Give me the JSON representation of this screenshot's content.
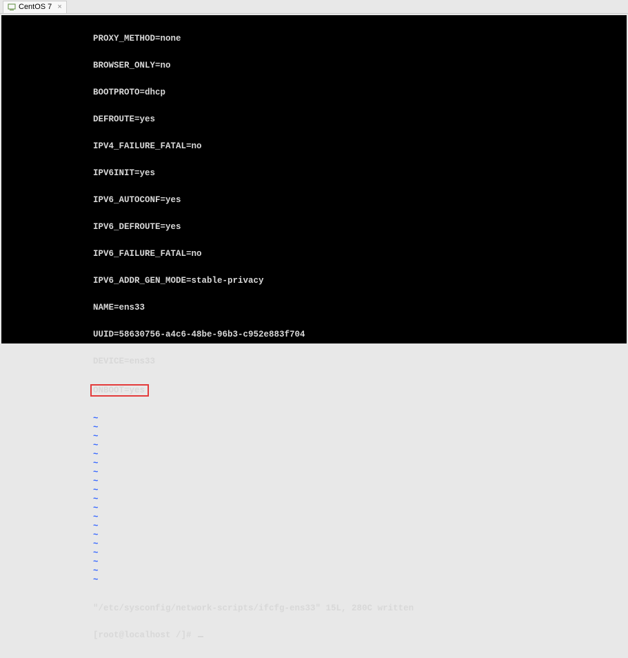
{
  "tab": {
    "label": "CentOS 7",
    "close_glyph": "×"
  },
  "terminal": {
    "config_lines": [
      "PROXY_METHOD=none",
      "BROWSER_ONLY=no",
      "BOOTPROTO=dhcp",
      "DEFROUTE=yes",
      "IPV4_FAILURE_FATAL=no",
      "IPV6INIT=yes",
      "IPV6_AUTOCONF=yes",
      "IPV6_DEFROUTE=yes",
      "IPV6_FAILURE_FATAL=no",
      "IPV6_ADDR_GEN_MODE=stable-privacy",
      "NAME=ens33",
      "UUID=58630756-a4c6-48be-96b3-c952e883f704",
      "DEVICE=ens33"
    ],
    "highlighted_line": "ONBOOT=yes",
    "tilde": "~",
    "tilde_count": 19,
    "status": "\"/etc/sysconfig/network-scripts/ifcfg-ens33\" 15L, 280C written",
    "prompt": "[root@localhost /]# "
  }
}
